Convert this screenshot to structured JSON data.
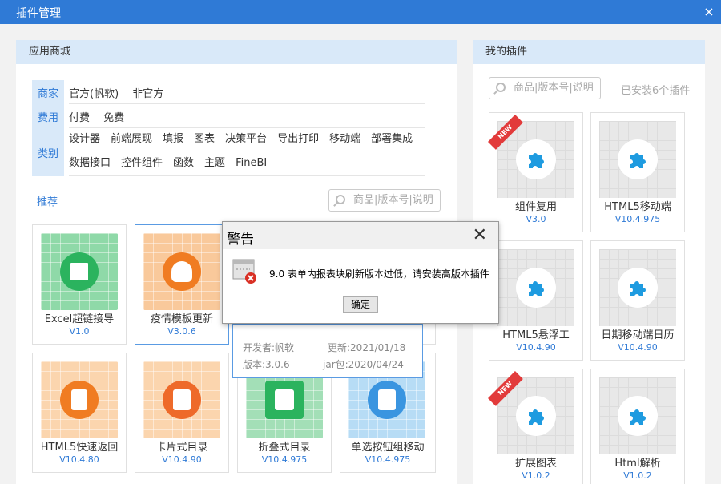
{
  "window": {
    "title": "插件管理",
    "close_label": "×"
  },
  "store": {
    "header": "应用商城",
    "tabs": [
      "商家",
      "费用",
      "类别"
    ],
    "filters": {
      "vendor": [
        "官方(帆软)",
        "非官方"
      ],
      "fee": [
        "付费",
        "免费"
      ],
      "category_row1": [
        "设计器",
        "前端展现",
        "填报",
        "图表",
        "决策平台",
        "导出打印",
        "移动端",
        "部署集成"
      ],
      "category_row2": [
        "数据接口",
        "控件组件",
        "函数",
        "主题",
        "FineBI"
      ]
    },
    "recommend_label": "推荐",
    "search_placeholder": "商品|版本号|说明",
    "cards": [
      {
        "name": "Excel超链接导",
        "version": "V1.0"
      },
      {
        "name": "疫情模板更新",
        "version": "V3.0.6"
      },
      {
        "name": "",
        "version": ""
      },
      {
        "name": "",
        "version": ""
      },
      {
        "name": "HTML5快速返回",
        "version": "V10.4.80"
      },
      {
        "name": "卡片式目录",
        "version": "V10.4.90"
      },
      {
        "name": "折叠式目录",
        "version": "V10.4.975"
      },
      {
        "name": "单选按钮组移动",
        "version": "V10.4.975"
      }
    ],
    "detail": {
      "developer": "开发者:帆软",
      "updated": "更新:2021/01/18",
      "version": "版本:3.0.6",
      "jar": "jar包:2020/04/24"
    }
  },
  "mine": {
    "header": "我的插件",
    "search_placeholder": "商品|版本号|说明",
    "installed": "已安装6个插件",
    "new_badge": "NEW",
    "cards": [
      {
        "name": "组件复用",
        "version": "V3.0",
        "is_new": true
      },
      {
        "name": "HTML5移动端",
        "version": "V10.4.975",
        "is_new": false
      },
      {
        "name": "HTML5悬浮工",
        "version": "V10.4.90",
        "is_new": false
      },
      {
        "name": "日期移动端日历",
        "version": "V10.4.90",
        "is_new": false
      },
      {
        "name": "扩展图表",
        "version": "V1.0.2",
        "is_new": true
      },
      {
        "name": "Html解析",
        "version": "V1.0.2",
        "is_new": false
      }
    ]
  },
  "dialog": {
    "title": "警告",
    "message": "9.0 表单内报表块刷新版本过低，请安装高版本插件",
    "ok_label": "确定",
    "close_label": "✕"
  },
  "colors": {
    "accent": "#2f7ad6",
    "header_bg": "#d9e9f9",
    "new_badge": "#e23b3b",
    "puzzle": "#1e9be0"
  }
}
